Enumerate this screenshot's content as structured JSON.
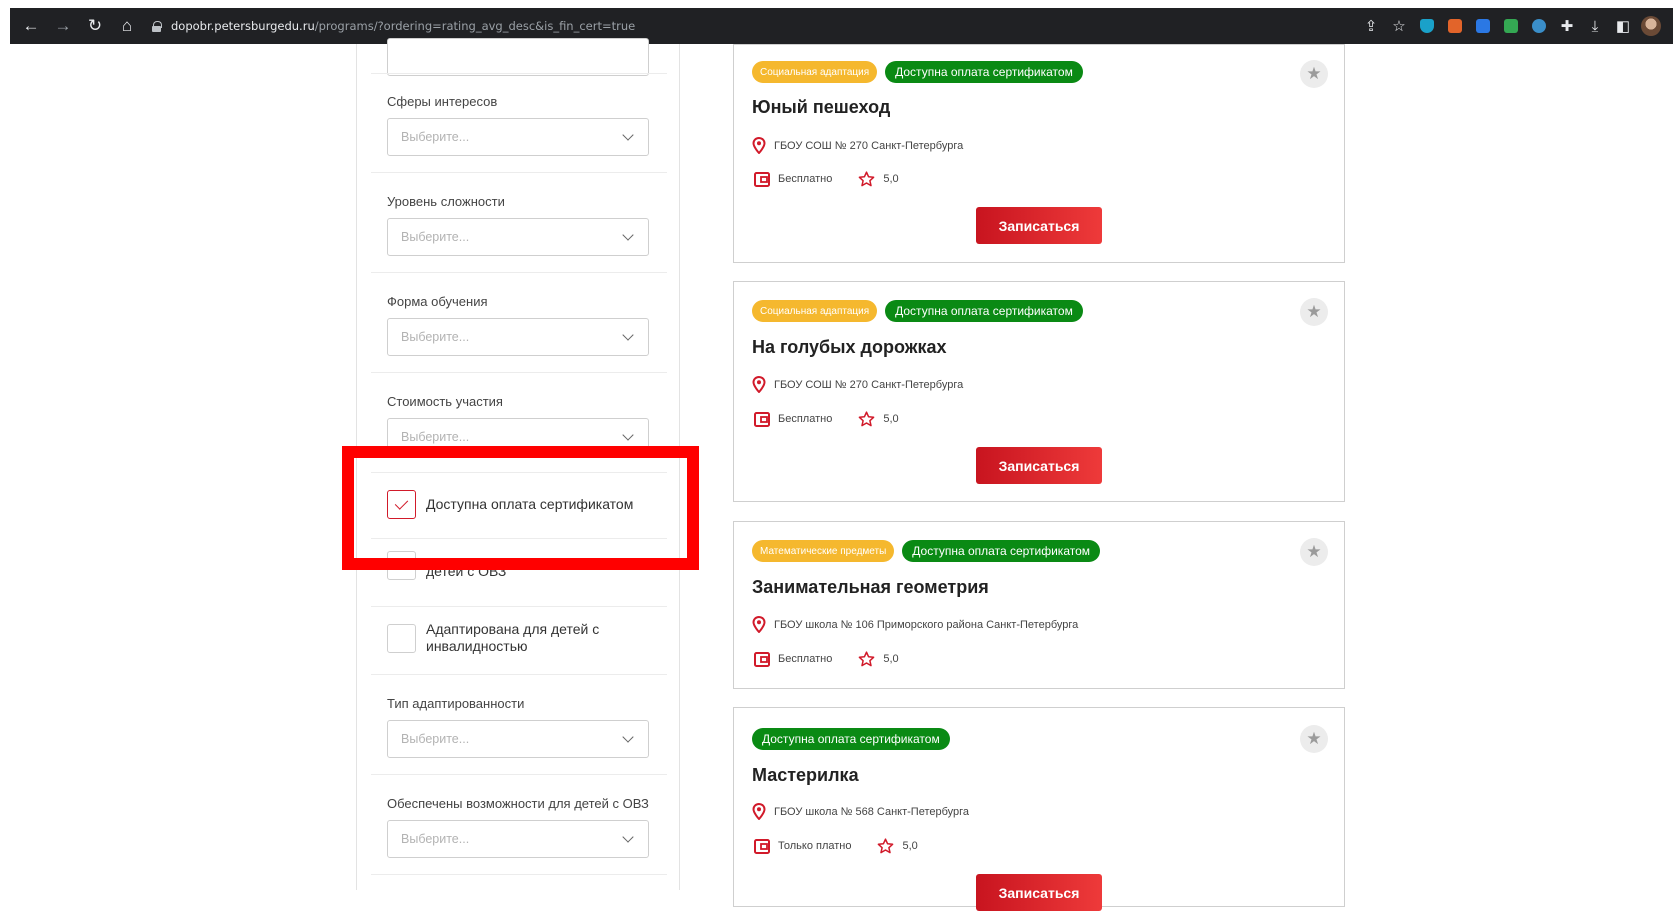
{
  "browser": {
    "url_host": "dopobr.petersburgedu.ru",
    "url_path": "/programs/?ordering=rating_avg_desc&is_fin_cert=true"
  },
  "sidebar": {
    "filters": [
      {
        "label": "Сферы интересов",
        "placeholder": "Выберите..."
      },
      {
        "label": "Уровень сложности",
        "placeholder": "Выберите..."
      },
      {
        "label": "Форма обучения",
        "placeholder": "Выберите..."
      },
      {
        "label": "Стоимость участия",
        "placeholder": "Выберите..."
      }
    ],
    "checkboxes": [
      {
        "label": "Доступна оплата сертификатом",
        "checked": true
      },
      {
        "label": "детей с ОВЗ",
        "checked": false
      },
      {
        "label": "Адаптирована для детей с инвалидностью",
        "checked": false
      }
    ],
    "filters_bottom": [
      {
        "label": "Тип адаптированности",
        "placeholder": "Выберите..."
      },
      {
        "label": "Обеспечены возможности для детей с ОВЗ",
        "placeholder": "Выберите..."
      }
    ]
  },
  "cards": [
    {
      "tag_category": "Социальная адаптация",
      "tag_certificate": "Доступна оплата сертификатом",
      "title": "Юный пешеход",
      "organization": "ГБОУ СОШ № 270 Санкт-Петербурга",
      "price": "Бесплатно",
      "rating": "5,0",
      "button": "Записаться"
    },
    {
      "tag_category": "Социальная адаптация",
      "tag_certificate": "Доступна оплата сертификатом",
      "title": "На голубых дорожках",
      "organization": "ГБОУ СОШ № 270 Санкт-Петербурга",
      "price": "Бесплатно",
      "rating": "5,0",
      "button": "Записаться"
    },
    {
      "tag_category": "Математические предметы",
      "tag_certificate": "Доступна оплата сертификатом",
      "title": "Занимательная геометрия",
      "organization": "ГБОУ школа № 106 Приморского района Санкт-Петербурга",
      "price": "Бесплатно",
      "rating": "5,0"
    },
    {
      "tag_certificate": "Доступна оплата сертификатом",
      "title": "Мастерилка",
      "organization": "ГБОУ школа № 568 Санкт-Петербурга",
      "price": "Только платно",
      "rating": "5,0",
      "button": "Записаться"
    }
  ],
  "colors": {
    "accent_red": "#d11a2a",
    "tag_orange": "#f5b82e",
    "tag_green": "#0a8a14",
    "highlight": "#ff0000"
  }
}
